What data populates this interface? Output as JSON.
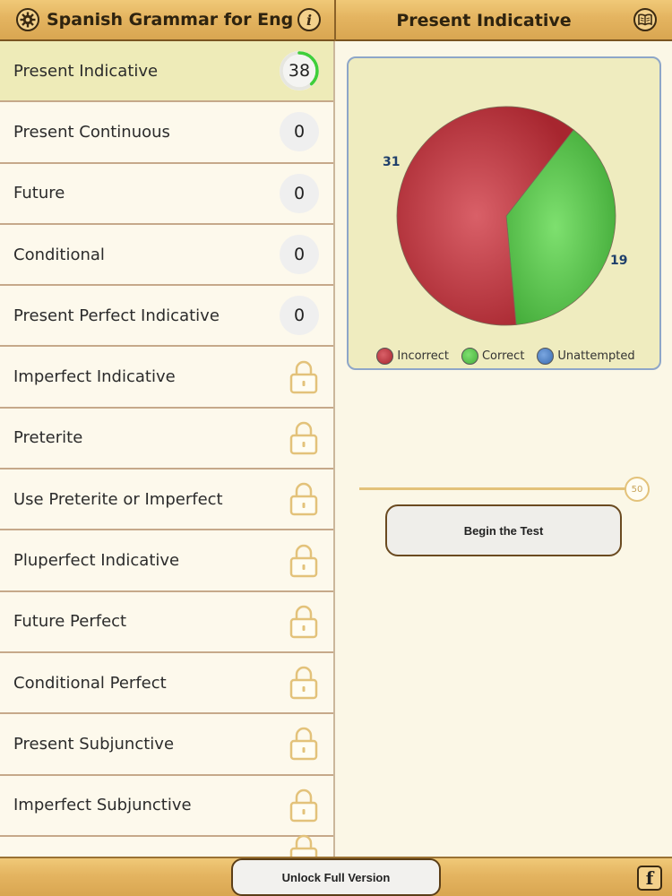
{
  "header": {
    "app_title": "Spanish Grammar for Engl…",
    "page_title": "Present Indicative",
    "icons": [
      "gear-icon",
      "info-icon",
      "book-icon"
    ]
  },
  "sidebar": {
    "items": [
      {
        "label": "Present Indicative",
        "score": "38",
        "progress": 0.38,
        "selected": true
      },
      {
        "label": "Present Continuous",
        "score": "0"
      },
      {
        "label": "Future",
        "score": "0"
      },
      {
        "label": "Conditional",
        "score": "0"
      },
      {
        "label": "Present Perfect Indicative",
        "score": "0"
      },
      {
        "label": "Imperfect Indicative",
        "locked": true
      },
      {
        "label": "Preterite",
        "locked": true
      },
      {
        "label": "Use Preterite or Imperfect",
        "locked": true
      },
      {
        "label": "Pluperfect Indicative",
        "locked": true
      },
      {
        "label": "Future Perfect",
        "locked": true
      },
      {
        "label": "Conditional Perfect",
        "locked": true
      },
      {
        "label": "Present Subjunctive",
        "locked": true
      },
      {
        "label": "Imperfect Subjunctive",
        "locked": true
      }
    ]
  },
  "chart_data": {
    "type": "pie",
    "slices": [
      {
        "name": "Incorrect",
        "value": 31,
        "color": "#b8363d"
      },
      {
        "name": "Correct",
        "value": 19,
        "color": "#5bc452"
      },
      {
        "name": "Unattempted",
        "value": 0,
        "color": "#4a7fc4"
      }
    ],
    "labels": [
      "31",
      "19"
    ],
    "legend": [
      "Incorrect",
      "Correct",
      "Unattempted"
    ],
    "legend_position": "bottom"
  },
  "test": {
    "question_count": "50",
    "begin_label": "Begin the Test"
  },
  "footer": {
    "unlock_label": "Unlock Full Version",
    "facebook_label": "f"
  },
  "colors": {
    "accent_green": "#3fcf3a",
    "lock_gold": "#e3c27a",
    "selected_row": "#eeebb8"
  }
}
